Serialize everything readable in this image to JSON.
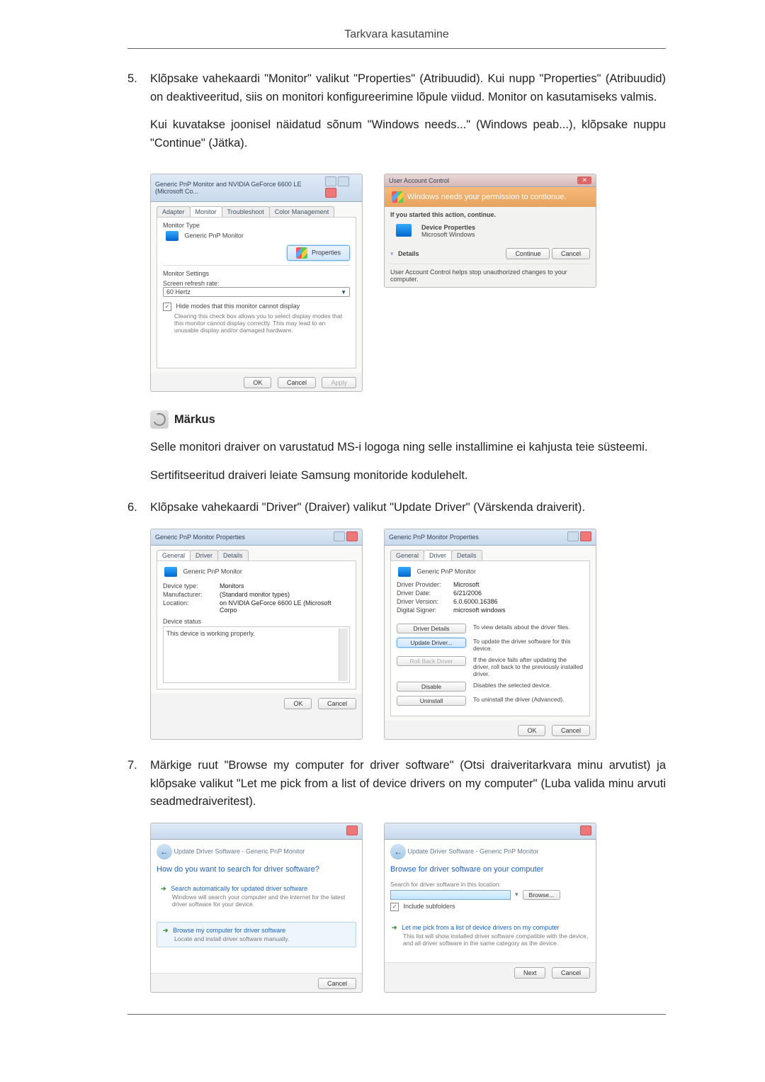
{
  "header": {
    "title": "Tarkvara kasutamine"
  },
  "step5": {
    "num": "5.",
    "text": "Klõpsake vahekaardi \"Monitor\" valikut \"Properties\" (Atribuudid). Kui nupp \"Properties\" (Atribuudid) on deaktiveeritud, siis on monitori konfigureerimine lõpule viidud. Monitor on kasutamiseks valmis.",
    "text2": "Kui kuvatakse joonisel näidatud sõnum \"Windows needs...\" (Windows peab...), klõpsake nuppu \"Continue\" (Jätka)."
  },
  "shotA": {
    "title": "Generic PnP Monitor and NVIDIA GeForce 6600 LE (Microsoft Co...",
    "tabs": {
      "adapter": "Adapter",
      "monitor": "Monitor",
      "trouble": "Troubleshoot",
      "color": "Color Management"
    },
    "monitor_type_label": "Monitor Type",
    "monitor_name": "Generic PnP Monitor",
    "properties_btn": "Properties",
    "settings_label": "Monitor Settings",
    "refresh_label": "Screen refresh rate:",
    "refresh_value": "60 Hertz",
    "hide_modes": "Hide modes that this monitor cannot display",
    "hide_modes_desc": "Clearing this check box allows you to select display modes that this monitor cannot display correctly. This may lead to an unusable display and/or damaged hardware.",
    "ok": "OK",
    "cancel": "Cancel",
    "apply": "Apply"
  },
  "shotB": {
    "title": "User Account Control",
    "band": "Windows needs your permission to contionue.",
    "started": "If you started this action, continue.",
    "prog_name": "Device Properties",
    "prog_pub": "Microsoft Windows",
    "details": "Details",
    "continue": "Continue",
    "cancel": "Cancel",
    "footer": "User Account Control helps stop unauthorized changes to your computer."
  },
  "note": {
    "title": "Märkus",
    "p1": "Selle monitori draiver on varustatud MS-i logoga ning selle installimine ei kahjusta teie süsteemi.",
    "p2": "Sertifitseeritud draiveri leiate Samsung monitoride kodulehelt."
  },
  "step6": {
    "num": "6.",
    "text": "Klõpsake vahekaardi \"Driver\" (Draiver) valikut \"Update Driver\" (Värskenda draiverit)."
  },
  "shotC": {
    "title": "Generic PnP Monitor Properties",
    "tabs": {
      "general": "General",
      "driver": "Driver",
      "details": "Details"
    },
    "dev_name": "Generic PnP Monitor",
    "kv": {
      "type_k": "Device type:",
      "type_v": "Monitors",
      "man_k": "Manufacturer:",
      "man_v": "(Standard monitor types)",
      "loc_k": "Location:",
      "loc_v": "on NVIDIA GeForce 6600 LE (Microsoft Corpo"
    },
    "status_label": "Device status",
    "status_text": "This device is working properly.",
    "ok": "OK",
    "cancel": "Cancel"
  },
  "shotD": {
    "title": "Generic PnP Monitor Properties",
    "tabs": {
      "general": "General",
      "driver": "Driver",
      "details": "Details"
    },
    "dev_name": "Generic PnP Monitor",
    "kv": {
      "prov_k": "Driver Provider:",
      "prov_v": "Microsoft",
      "date_k": "Driver Date:",
      "date_v": "6/21/2006",
      "ver_k": "Driver Version:",
      "ver_v": "6.0.6000.16386",
      "sign_k": "Digital Signer:",
      "sign_v": "microsoft windows"
    },
    "btns": {
      "details": "Driver Details",
      "details_d": "To view details about the driver files.",
      "update": "Update Driver...",
      "update_d": "To update the driver software for this device.",
      "roll": "Roll Back Driver",
      "roll_d": "If the device fails after updating the driver, roll back to the previously installed driver.",
      "disable": "Disable",
      "disable_d": "Disables the selected device.",
      "uninst": "Uninstall",
      "uninst_d": "To uninstall the driver (Advanced)."
    },
    "ok": "OK",
    "cancel": "Cancel"
  },
  "step7": {
    "num": "7.",
    "text": "Märkige ruut \"Browse my computer for driver software\" (Otsi draiveritarkvara minu arvutist) ja klõpsake valikut \"Let me pick from a list of device drivers on my computer\" (Luba valida minu arvuti seadmedraiveritest)."
  },
  "shotE": {
    "breadcrumb": "Update Driver Software - Generic PnP Monitor",
    "heading": "How do you want to search for driver software?",
    "opt1_title": "Search automatically for updated driver software",
    "opt1_desc": "Windows will search your computer and the Internet for the latest driver software for your device.",
    "opt2_title": "Browse my computer for driver software",
    "opt2_desc": "Locate and install driver software manually.",
    "cancel": "Cancel"
  },
  "shotF": {
    "breadcrumb": "Update Driver Software - Generic PnP Monitor",
    "heading": "Browse for driver software on your computer",
    "loc_label": "Search for driver software in this location:",
    "browse": "Browse...",
    "include": "Include subfolders",
    "opt_title": "Let me pick from a list of device drivers on my computer",
    "opt_desc": "This list will show installed driver software compatible with the device, and all driver software in the same category as the device.",
    "next": "Next",
    "cancel": "Cancel"
  }
}
